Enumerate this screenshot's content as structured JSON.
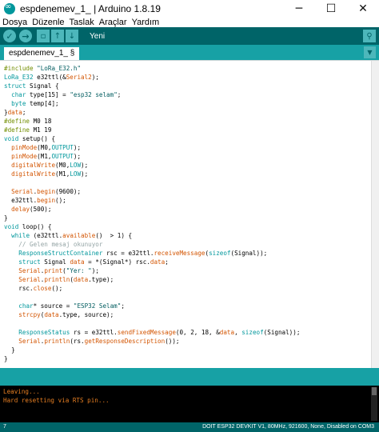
{
  "window": {
    "title": "espdenemev_1_ | Arduino 1.8.19",
    "minimize": "─",
    "maximize": "☐",
    "close": "✕"
  },
  "menu": [
    "Dosya",
    "Düzenle",
    "Taslak",
    "Araçlar",
    "Yardım"
  ],
  "toolbar": {
    "verify_icon": "✓",
    "upload_icon": "→",
    "new_icon": "▫",
    "open_icon": "↑",
    "save_icon": "↓",
    "hover_label": "Yeni",
    "serial_icon": "⚲"
  },
  "tab": {
    "label": "espdenemev_1_ §",
    "menu_icon": "▼"
  },
  "code_lines": [
    "#include \"LoRa_E32.h\"",
    "LoRa_E32 e32ttl(&Serial2);",
    "struct Signal {",
    "  char type[15] = \"esp32 selam\";",
    "  byte temp[4];",
    "}data;",
    "#define M0 18",
    "#define M1 19",
    "void setup() {",
    "  pinMode(M0,OUTPUT);",
    "  pinMode(M1,OUTPUT);",
    "  digitalWrite(M0,LOW);",
    "  digitalWrite(M1,LOW);",
    "",
    "  Serial.begin(9600);",
    "  e32ttl.begin();",
    "  delay(500);",
    "}",
    "void loop() {",
    "  while (e32ttl.available()  > 1) {",
    "    // Gelen mesaj okunuyor",
    "    ResponseStructContainer rsc = e32ttl.receiveMessage(sizeof(Signal));",
    "    struct Signal data = *(Signal*) rsc.data;",
    "    Serial.print(\"Yer: \");",
    "    Serial.println(data.type);",
    "    rsc.close();",
    "",
    "    char* source = \"ESP32 Selam\";",
    "    strcpy(data.type, source);",
    "",
    "    ResponseStatus rs = e32ttl.sendFixedMessage(0, 2, 18, &data, sizeof(Signal));",
    "    Serial.println(rs.getResponseDescription());",
    "  }",
    "}"
  ],
  "console_lines": [
    "Leaving...",
    "Hard resetting via RTS pin..."
  ],
  "status": {
    "line": "7",
    "board": "DOIT ESP32 DEVKIT V1, 80MHz, 921600, None, Disabled on COM3"
  },
  "colors": {
    "toolbar": "#006468",
    "tabbar": "#17a1a5",
    "console_text": "#e67e22"
  }
}
